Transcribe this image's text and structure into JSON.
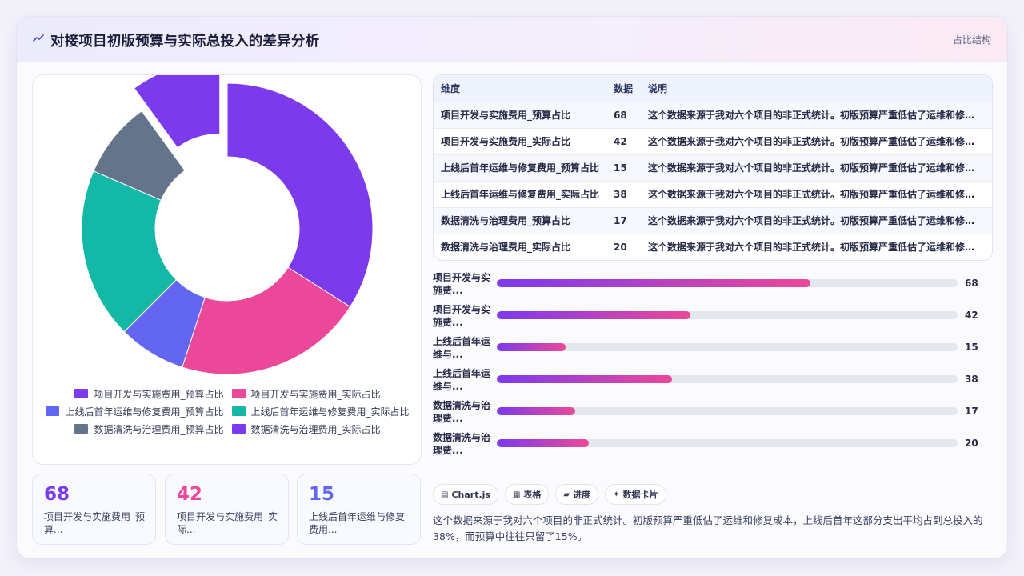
{
  "header": {
    "icon": "trend-line-icon",
    "title": "对接项目初版预算与实际总投入的差异分析",
    "tag": "占比结构"
  },
  "colors": {
    "accent": "#7c3aed",
    "pink": "#ec4899",
    "indigo": "#6366f1",
    "teal": "#14b8a6",
    "slate": "#64748b"
  },
  "chart_data": {
    "type": "pie",
    "donut": true,
    "labels": [
      "项目开发与实施费用_预算占比",
      "项目开发与实施费用_实际占比",
      "上线后首年运维与修复费用_预算占比",
      "上线后首年运维与修复费用_实际占比",
      "数据清洗与治理费用_预算占比",
      "数据清洗与治理费用_实际占比"
    ],
    "values": [
      68,
      42,
      15,
      38,
      17,
      20
    ],
    "colors": [
      "#7c3aed",
      "#ec4899",
      "#6366f1",
      "#14b8a6",
      "#64748b",
      "#7c3aed"
    ],
    "exploded": [
      5
    ],
    "legend_position": "bottom"
  },
  "table": {
    "headers": [
      "维度",
      "数据",
      "说明"
    ],
    "rows": [
      {
        "dim": "项目开发与实施费用_预算占比",
        "value": "68",
        "desc": "这个数据来源于我对六个项目的非正式统计。初版预算严重低估了运维和修复成本"
      },
      {
        "dim": "项目开发与实施费用_实际占比",
        "value": "42",
        "desc": "这个数据来源于我对六个项目的非正式统计。初版预算严重低估了运维和修复成本"
      },
      {
        "dim": "上线后首年运维与修复费用_预算占比",
        "value": "15",
        "desc": "这个数据来源于我对六个项目的非正式统计。初版预算严重低估了运维和修复成本"
      },
      {
        "dim": "上线后首年运维与修复费用_实际占比",
        "value": "38",
        "desc": "这个数据来源于我对六个项目的非正式统计。初版预算严重低估了运维和修复成本"
      },
      {
        "dim": "数据清洗与治理费用_预算占比",
        "value": "17",
        "desc": "这个数据来源于我对六个项目的非正式统计。初版预算严重低估了运维和修复成本"
      },
      {
        "dim": "数据清洗与治理费用_实际占比",
        "value": "20",
        "desc": "这个数据来源于我对六个项目的非正式统计。初版预算严重低估了运维和修复成本"
      }
    ]
  },
  "progress": {
    "max": 100,
    "items": [
      {
        "label": "项目开发与实施费...",
        "value": 68
      },
      {
        "label": "项目开发与实施费...",
        "value": 42
      },
      {
        "label": "上线后首年运维与...",
        "value": 15
      },
      {
        "label": "上线后首年运维与...",
        "value": 38
      },
      {
        "label": "数据清洗与治理费...",
        "value": 17
      },
      {
        "label": "数据清洗与治理费...",
        "value": 20
      }
    ]
  },
  "stats": [
    {
      "value": "68",
      "label": "项目开发与实施费用_预算...",
      "color": "#7c3aed"
    },
    {
      "value": "42",
      "label": "项目开发与实施费用_实际...",
      "color": "#ec4899"
    },
    {
      "value": "15",
      "label": "上线后首年运维与修复费用...",
      "color": "#6366f1"
    }
  ],
  "chips": [
    {
      "icon": "chart-icon",
      "glyph": "▤",
      "label": "Chart.js"
    },
    {
      "icon": "table-icon",
      "glyph": "▦",
      "label": "表格"
    },
    {
      "icon": "progress-icon",
      "glyph": "▰",
      "label": "进度"
    },
    {
      "icon": "card-icon",
      "glyph": "✦",
      "label": "数据卡片"
    }
  ],
  "summary": "这个数据来源于我对六个项目的非正式统计。初版预算严重低估了运维和修复成本，上线后首年这部分支出平均占到总投入的38%，而预算中往往只留了15%。"
}
